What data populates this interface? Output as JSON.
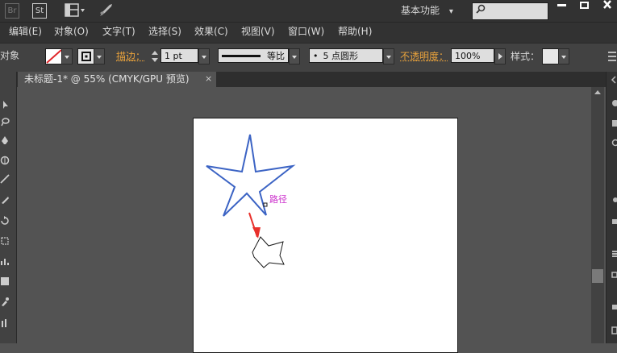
{
  "titlebar": {
    "br_label": "Br",
    "st_label": "St",
    "workspace": "基本功能",
    "workspace_arrow": "▾",
    "search_placeholder": ""
  },
  "menubar": {
    "items": [
      {
        "label": "编辑(E)"
      },
      {
        "label": "对象(O)"
      },
      {
        "label": "文字(T)"
      },
      {
        "label": "选择(S)"
      },
      {
        "label": "效果(C)"
      },
      {
        "label": "视图(V)"
      },
      {
        "label": "窗口(W)"
      },
      {
        "label": "帮助(H)"
      }
    ]
  },
  "controlbar": {
    "object_label": "对象",
    "stroke_label": "描边：",
    "stroke_weight": "1 pt",
    "stroke_profile": "等比",
    "brush": "5 点圆形",
    "brush_dot": "•",
    "opacity_label": "不透明度：",
    "opacity_value": "100%",
    "style_label": "样式："
  },
  "document": {
    "tab_label": "未标题-1* @ 55% (CMYK/GPU 预览)",
    "tab_close": "×"
  },
  "canvas": {
    "path_label": "路径",
    "arrow_color": "#e8302b",
    "star_color": "#3b63c4"
  }
}
